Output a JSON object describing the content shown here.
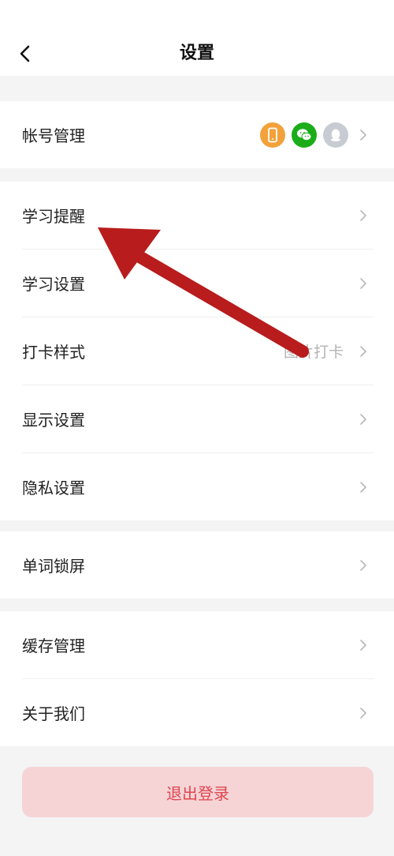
{
  "header": {
    "title": "设置"
  },
  "account": {
    "label": "帐号管理",
    "icons": [
      {
        "name": "phone-icon",
        "color": "#f3a13b"
      },
      {
        "name": "wechat-icon",
        "color": "#1aad19"
      },
      {
        "name": "qq-icon",
        "color": "#c8ccd2"
      }
    ]
  },
  "study_group": {
    "items": [
      {
        "label": "学习提醒"
      },
      {
        "label": "学习设置"
      },
      {
        "label": "打卡样式",
        "value": "图片打卡"
      },
      {
        "label": "显示设置"
      },
      {
        "label": "隐私设置"
      }
    ]
  },
  "lockscreen_group": {
    "items": [
      {
        "label": "单词锁屏"
      }
    ]
  },
  "misc_group": {
    "items": [
      {
        "label": "缓存管理"
      },
      {
        "label": "关于我们"
      }
    ]
  },
  "logout": {
    "label": "退出登录"
  },
  "colors": {
    "annotation_arrow": "#b81c1c",
    "logout_bg": "#f6d4d6",
    "logout_text": "#e0464f"
  }
}
